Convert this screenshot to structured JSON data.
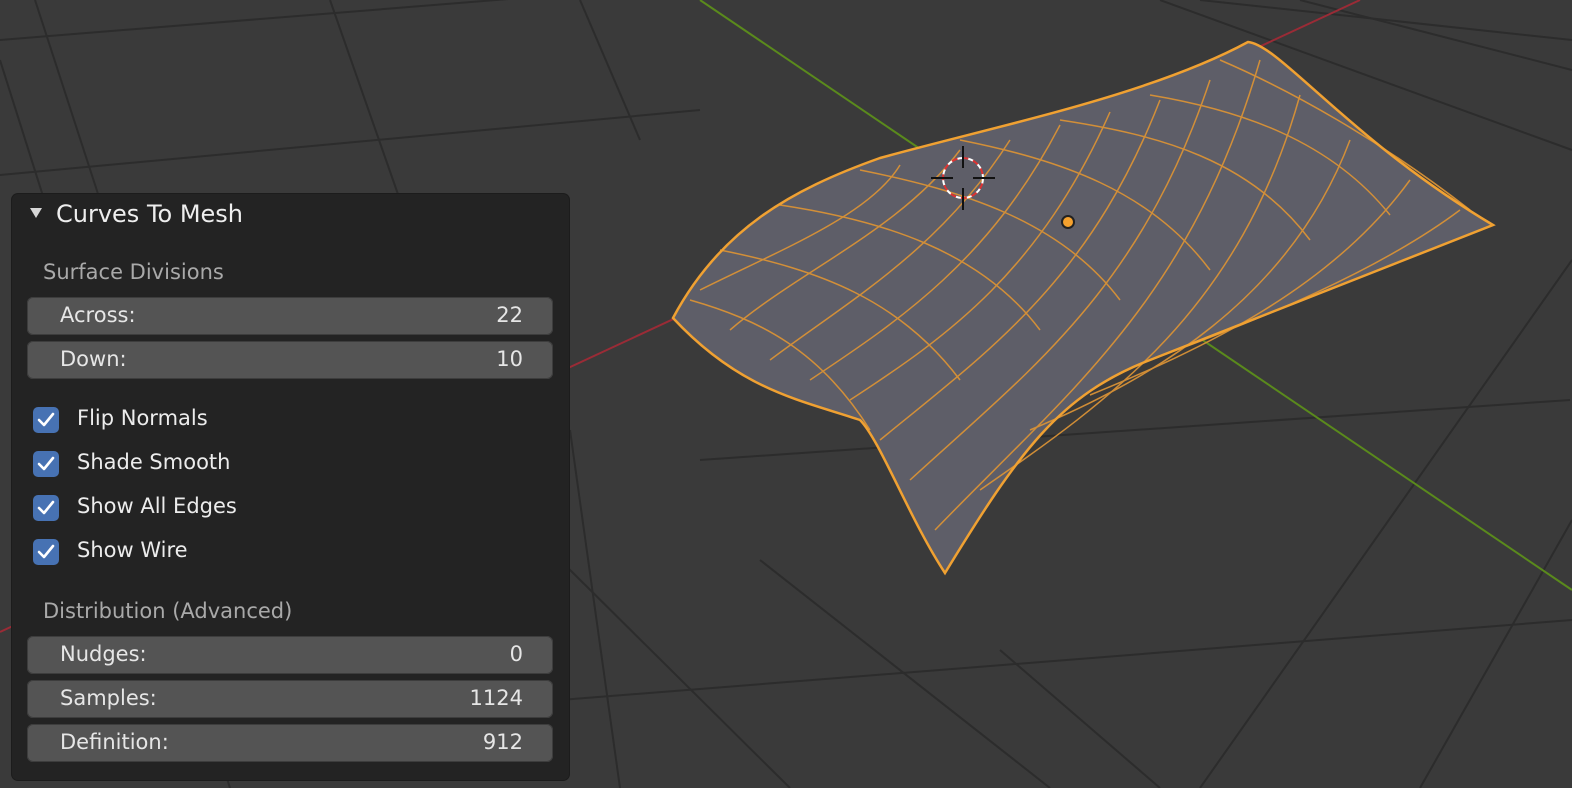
{
  "panel": {
    "title": "Curves To Mesh",
    "surface_divisions": {
      "label": "Surface Divisions",
      "fields": [
        {
          "label": "Across:",
          "value": "22"
        },
        {
          "label": "Down:",
          "value": "10"
        }
      ]
    },
    "options": [
      {
        "label": "Flip Normals",
        "checked": true
      },
      {
        "label": "Shade Smooth",
        "checked": true
      },
      {
        "label": "Show All Edges",
        "checked": true
      },
      {
        "label": "Show Wire",
        "checked": true
      }
    ],
    "distribution": {
      "label": "Distribution (Advanced)",
      "fields": [
        {
          "label": "Nudges:",
          "value": "0"
        },
        {
          "label": "Samples:",
          "value": "1124"
        },
        {
          "label": "Definition:",
          "value": "912"
        }
      ]
    }
  },
  "colors": {
    "background": "#3a3a3a",
    "grid": "#2b2b2b",
    "x_axis": "#9a2b36",
    "y_axis": "#5a8a1c",
    "mesh_fill": "#5e5e68",
    "wire": "#e8952f",
    "checkbox": "#4772b3"
  },
  "icons": [
    "collapse-triangle-icon",
    "checkmark-icon",
    "3d-cursor-icon",
    "object-origin-icon"
  ]
}
